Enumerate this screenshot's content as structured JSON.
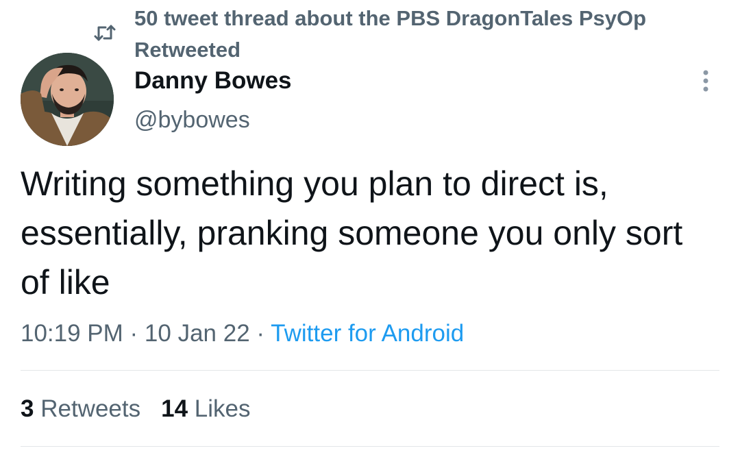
{
  "retweet": {
    "icon": "retweet-icon",
    "line1": "50 tweet thread about the PBS DragonTales PsyOp",
    "line2": "Retweeted"
  },
  "author": {
    "display_name": "Danny Bowes",
    "handle": "@bybowes",
    "avatar": "profile-photo"
  },
  "more_icon": "more-vertical-icon",
  "tweet": {
    "text": "Writing something you plan to direct is, essentially, pranking someone you only sort of like"
  },
  "meta": {
    "time": "10:19 PM",
    "separator1": " · ",
    "date": "10 Jan 22",
    "separator2": " · ",
    "source": "Twitter for Android"
  },
  "stats": {
    "retweets_count": "3",
    "retweets_label": "Retweets",
    "likes_count": "14",
    "likes_label": "Likes"
  },
  "colors": {
    "text_primary": "#0f1419",
    "text_secondary": "#536471",
    "link": "#1d9bf0",
    "divider": "#e3e6e8"
  }
}
